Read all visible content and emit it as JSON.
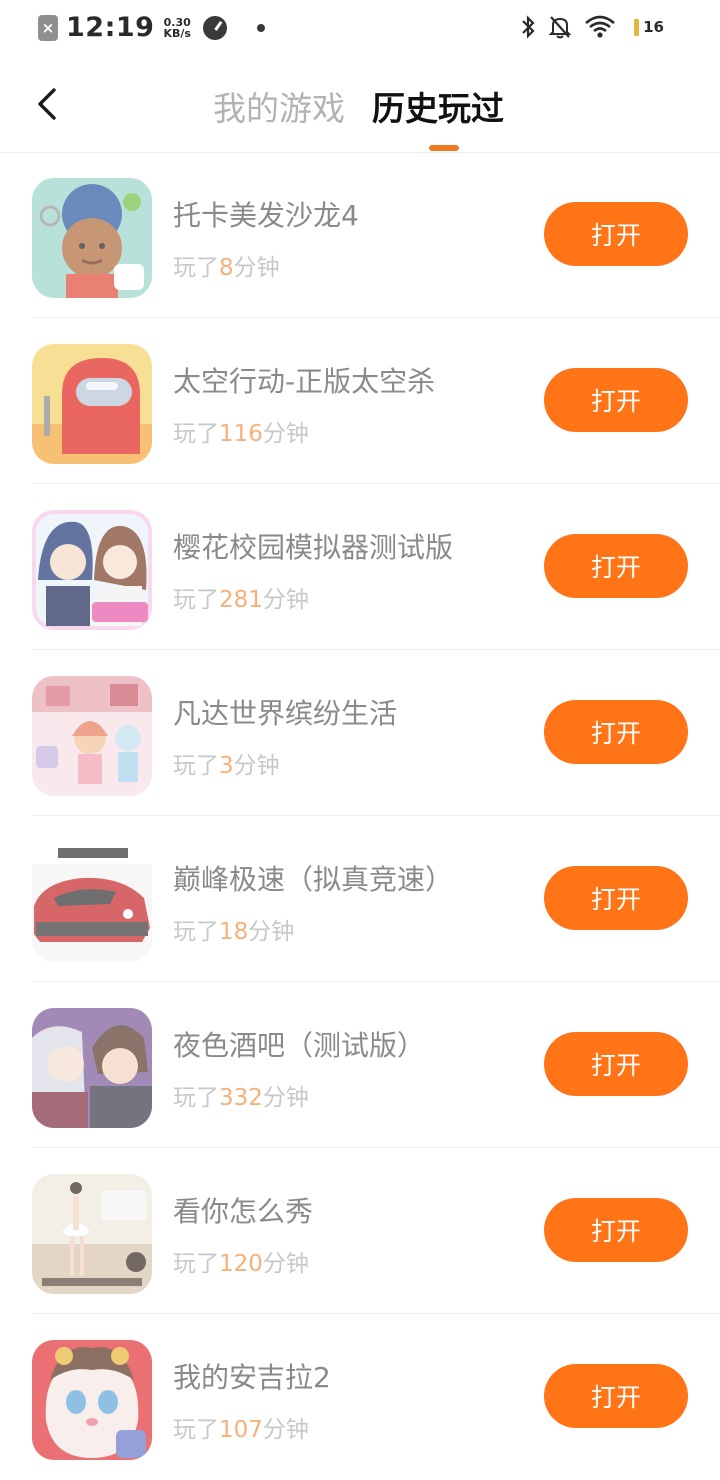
{
  "status_bar": {
    "time": "12:19",
    "speed_value": "0.30",
    "speed_unit": "KB/s",
    "battery": "16",
    "icons": [
      "close-notification-icon",
      "gauge-icon",
      "bluetooth-icon",
      "bell-muted-icon",
      "wifi-icon",
      "battery-icon"
    ]
  },
  "header": {
    "tabs": [
      {
        "label": "我的游戏",
        "active": false
      },
      {
        "label": "历史玩过",
        "active": true
      }
    ],
    "accent_color": "#f07a22"
  },
  "games": [
    {
      "name": "托卡美发沙龙4",
      "prefix": "玩了",
      "minutes": "8",
      "suffix": "分钟",
      "button": "打开"
    },
    {
      "name": "太空行动-正版太空杀",
      "prefix": "玩了",
      "minutes": "116",
      "suffix": "分钟",
      "button": "打开"
    },
    {
      "name": "樱花校园模拟器测试版",
      "prefix": "玩了",
      "minutes": "281",
      "suffix": "分钟",
      "button": "打开"
    },
    {
      "name": "凡达世界缤纷生活",
      "prefix": "玩了",
      "minutes": "3",
      "suffix": "分钟",
      "button": "打开"
    },
    {
      "name": "巅峰极速（拟真竞速）",
      "prefix": "玩了",
      "minutes": "18",
      "suffix": "分钟",
      "button": "打开"
    },
    {
      "name": "夜色酒吧（测试版）",
      "prefix": "玩了",
      "minutes": "332",
      "suffix": "分钟",
      "button": "打开"
    },
    {
      "name": "看你怎么秀",
      "prefix": "玩了",
      "minutes": "120",
      "suffix": "分钟",
      "button": "打开"
    },
    {
      "name": "我的安吉拉2",
      "prefix": "玩了",
      "minutes": "107",
      "suffix": "分钟",
      "button": "打开"
    }
  ],
  "button_color": "#ff7417"
}
